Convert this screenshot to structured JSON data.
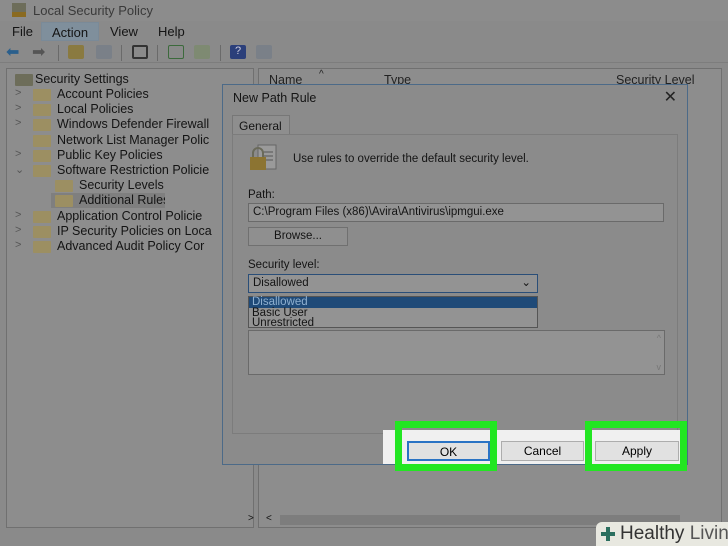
{
  "window": {
    "title": "Local Security Policy"
  },
  "menu": [
    "File",
    "Action",
    "View",
    "Help"
  ],
  "tree": {
    "root": "Security Settings",
    "items": [
      {
        "label": "Account Policies",
        "chev": ">",
        "indent": 0
      },
      {
        "label": "Local Policies",
        "chev": ">",
        "indent": 0
      },
      {
        "label": "Windows Defender Firewall",
        "chev": ">",
        "indent": 0
      },
      {
        "label": "Network List Manager Polic",
        "chev": "",
        "indent": 0
      },
      {
        "label": "Public Key Policies",
        "chev": ">",
        "indent": 0
      },
      {
        "label": "Software Restriction Policie",
        "chev": "v",
        "indent": 0
      },
      {
        "label": "Security Levels",
        "chev": "",
        "indent": 1
      },
      {
        "label": "Additional Rules",
        "chev": "",
        "indent": 1,
        "selected": true
      },
      {
        "label": "Application Control Policie",
        "chev": ">",
        "indent": 0
      },
      {
        "label": "IP Security Policies on Loca",
        "chev": ">",
        "indent": 0
      },
      {
        "label": "Advanced Audit Policy Cor",
        "chev": ">",
        "indent": 0
      }
    ]
  },
  "columns": [
    "Name",
    "Type",
    "Security Level"
  ],
  "dialog": {
    "title": "New Path Rule",
    "tab": "General",
    "intro": "Use rules to override the default security level.",
    "path_label": "Path:",
    "path_value": "C:\\Program Files (x86)\\Avira\\Antivirus\\ipmgui.exe",
    "browse": "Browse...",
    "security_label": "Security level:",
    "security_value": "Disallowed",
    "options": [
      "Disallowed",
      "Basic User",
      "Unrestricted"
    ],
    "ok": "OK",
    "cancel": "Cancel",
    "apply": "Apply"
  },
  "watermark": {
    "word1": "Healthy",
    "word2": "Living"
  },
  "colors": {
    "highlight": "#22e622"
  }
}
